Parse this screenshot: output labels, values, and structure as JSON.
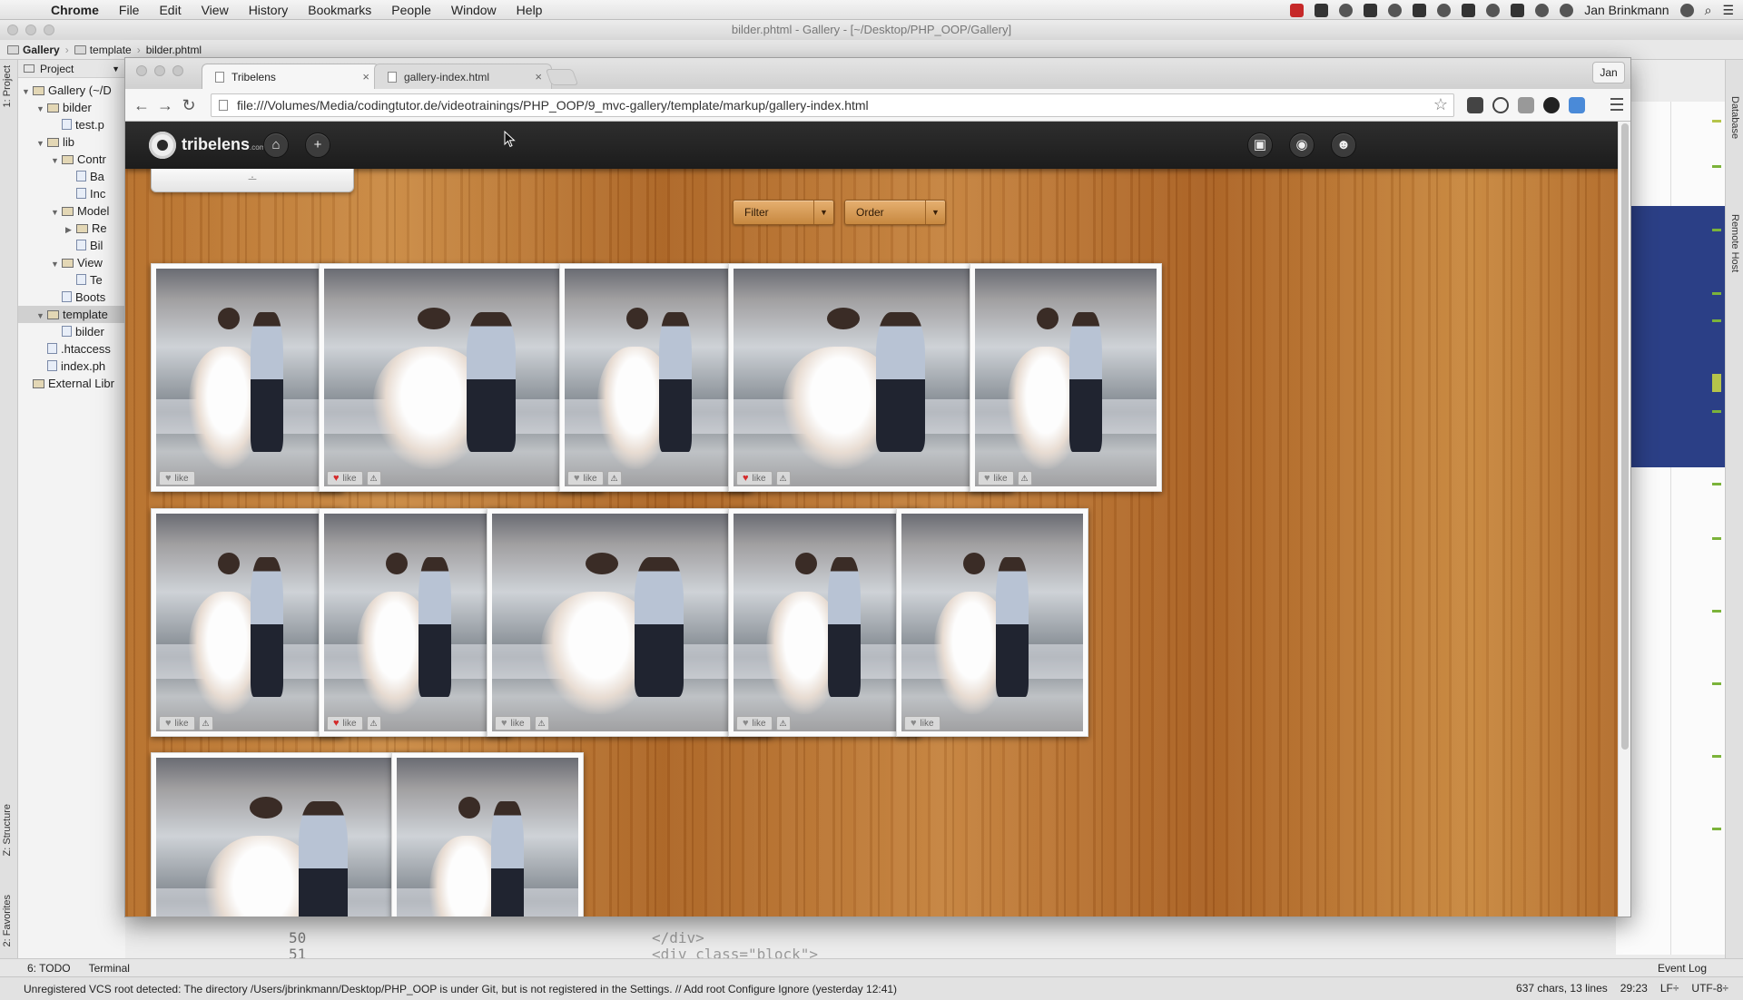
{
  "menubar": {
    "app": "Chrome",
    "items": [
      "File",
      "Edit",
      "View",
      "History",
      "Bookmarks",
      "People",
      "Window",
      "Help"
    ],
    "user": "Jan Brinkmann"
  },
  "ide": {
    "window_title": "bilder.phtml - Gallery - [~/Desktop/PHP_OOP/Gallery]",
    "breadcrumbs": [
      "Gallery",
      "template",
      "bilder.phtml"
    ],
    "project_label": "Project",
    "left_strip": {
      "project": "1: Project",
      "structure": "Z: Structure",
      "favorites": "2: Favorites"
    },
    "right_strip": {
      "database": "Database",
      "remote": "Remote Host"
    },
    "tree": [
      {
        "label": "Gallery (~/D",
        "depth": 0,
        "type": "folder",
        "open": true
      },
      {
        "label": "bilder",
        "depth": 1,
        "type": "folder",
        "open": true
      },
      {
        "label": "test.p",
        "depth": 2,
        "type": "file"
      },
      {
        "label": "lib",
        "depth": 1,
        "type": "folder",
        "open": true
      },
      {
        "label": "Contr",
        "depth": 2,
        "type": "folder",
        "open": true
      },
      {
        "label": "Ba",
        "depth": 3,
        "type": "file"
      },
      {
        "label": "Inc",
        "depth": 3,
        "type": "file"
      },
      {
        "label": "Model",
        "depth": 2,
        "type": "folder",
        "open": true
      },
      {
        "label": "Re",
        "depth": 3,
        "type": "folder",
        "open": false
      },
      {
        "label": "Bil",
        "depth": 3,
        "type": "file"
      },
      {
        "label": "View",
        "depth": 2,
        "type": "folder",
        "open": true
      },
      {
        "label": "Te",
        "depth": 3,
        "type": "file"
      },
      {
        "label": "Boots",
        "depth": 2,
        "type": "file"
      },
      {
        "label": "template",
        "depth": 1,
        "type": "folder",
        "open": true,
        "selected": true
      },
      {
        "label": "bilder",
        "depth": 2,
        "type": "file"
      },
      {
        "label": ".htaccess",
        "depth": 1,
        "type": "file"
      },
      {
        "label": "index.ph",
        "depth": 1,
        "type": "file"
      },
      {
        "label": "External Libr",
        "depth": 0,
        "type": "lib"
      }
    ],
    "code_lines": [
      "50",
      "51"
    ],
    "code_text": [
      "</div>",
      "<div class=\"block\">"
    ],
    "bottom_tools": {
      "todo": "6: TODO",
      "terminal": "Terminal",
      "event_log": "Event Log"
    },
    "status_message": "Unregistered VCS root detected: The directory /Users/jbrinkmann/Desktop/PHP_OOP is under Git, but is not registered in the Settings. // Add root  Configure  Ignore (yesterday 12:41)",
    "status_meta": [
      "637 chars, 13 lines",
      "29:23",
      "LF÷",
      "UTF-8÷"
    ]
  },
  "browser": {
    "tabs": [
      {
        "title": "Tribelens",
        "active": true
      },
      {
        "title": "gallery-index.html",
        "active": false
      }
    ],
    "profile": "Jan",
    "url": "file:///Volumes/Media/codingtutor.de/videotrainings/PHP_OOP/9_mvc-gallery/template/markup/gallery-index.html"
  },
  "site": {
    "logo": "tribelens",
    "logo_suffix": ".com",
    "filter_label": "Filter",
    "order_label": "Order",
    "like_label": "like",
    "photos": [
      {
        "liked": false,
        "flag": false
      },
      {
        "liked": true,
        "flag": true
      },
      {
        "liked": false,
        "flag": true
      },
      {
        "liked": true,
        "flag": true
      },
      {
        "liked": false,
        "flag": true
      },
      {
        "liked": false,
        "flag": true
      },
      {
        "liked": true,
        "flag": true
      },
      {
        "liked": false,
        "flag": true
      },
      {
        "liked": false,
        "flag": true
      },
      {
        "liked": false,
        "flag": false
      },
      {
        "liked": false,
        "flag": false
      },
      {
        "liked": false,
        "flag": false
      }
    ]
  },
  "colors": {
    "header_bg": "#1c1c1c",
    "wood": "#b56f2c",
    "like_red": "#d42a2a",
    "ide_blue": "#2b3f86"
  }
}
